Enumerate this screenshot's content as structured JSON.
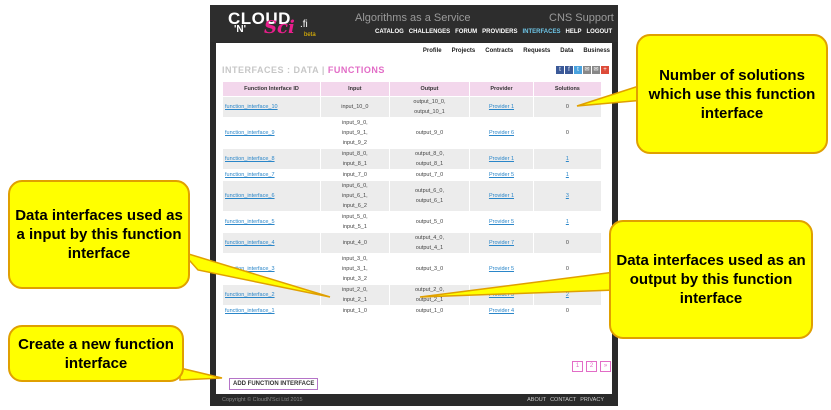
{
  "header": {
    "logo_main": "CLOUD",
    "logo_n": "'N'",
    "logo_sci": "Sci",
    "logo_fi": ".fi",
    "logo_beta": "beta",
    "tagline": "Algorithms as a Service",
    "support": "CNS Support"
  },
  "main_nav": [
    "CATALOG",
    "CHALLENGES",
    "FORUM",
    "PROVIDERS",
    "INTERFACES",
    "HELP",
    "LOGOUT"
  ],
  "main_nav_active": "INTERFACES",
  "sub_nav": [
    "Profile",
    "Projects",
    "Contracts",
    "Requests",
    "Data",
    "Business"
  ],
  "page": {
    "heading_prefix": "INTERFACES : DATA",
    "heading_sep": "|",
    "heading_current": "FUNCTIONS"
  },
  "social_icons": [
    "t",
    "f",
    "t",
    "✉",
    "✉",
    "+"
  ],
  "social_colors": [
    "#3b5998",
    "#3b5998",
    "#4aa3df",
    "#888888",
    "#888888",
    "#dd4b39"
  ],
  "table": {
    "headers": [
      "Function Interface ID",
      "Input",
      "Output",
      "Provider",
      "Solutions"
    ],
    "rows": [
      {
        "id": "function_interface_10",
        "inputs": [
          "input_10_0"
        ],
        "outputs": [
          "output_10_0,",
          "output_10_1"
        ],
        "provider": "Provider 1",
        "solutions": "0"
      },
      {
        "id": "function_interface_9",
        "inputs": [
          "input_9_0,",
          "input_9_1,",
          "input_9_2"
        ],
        "outputs": [
          "output_9_0"
        ],
        "provider": "Provider 6",
        "solutions": "0"
      },
      {
        "id": "function_interface_8",
        "inputs": [
          "input_8_0,",
          "input_8_1"
        ],
        "outputs": [
          "output_8_0,",
          "output_8_1"
        ],
        "provider": "Provider 1",
        "solutions": "1"
      },
      {
        "id": "function_interface_7",
        "inputs": [
          "input_7_0"
        ],
        "outputs": [
          "output_7_0"
        ],
        "provider": "Provider 5",
        "solutions": "1"
      },
      {
        "id": "function_interface_6",
        "inputs": [
          "input_6_0,",
          "input_6_1,",
          "input_6_2"
        ],
        "outputs": [
          "output_6_0,",
          "output_6_1"
        ],
        "provider": "Provider 1",
        "solutions": "3"
      },
      {
        "id": "function_interface_5",
        "inputs": [
          "input_5_0,",
          "input_5_1"
        ],
        "outputs": [
          "output_5_0"
        ],
        "provider": "Provider 5",
        "solutions": "1"
      },
      {
        "id": "function_interface_4",
        "inputs": [
          "input_4_0"
        ],
        "outputs": [
          "output_4_0,",
          "output_4_1"
        ],
        "provider": "Provider 7",
        "solutions": "0"
      },
      {
        "id": "function_interface_3",
        "inputs": [
          "input_3_0,",
          "input_3_1,",
          "input_3_2"
        ],
        "outputs": [
          "output_3_0"
        ],
        "provider": "Provider 5",
        "solutions": "0"
      },
      {
        "id": "function_interface_2",
        "inputs": [
          "input_2_0,",
          "input_2_1"
        ],
        "outputs": [
          "output_2_0,",
          "output_2_1"
        ],
        "provider": "Provider 3",
        "solutions": "2"
      },
      {
        "id": "function_interface_1",
        "inputs": [
          "input_1_0"
        ],
        "outputs": [
          "output_1_0"
        ],
        "provider": "Provider 4",
        "solutions": "0"
      }
    ]
  },
  "pagination": [
    "1",
    "2",
    "»"
  ],
  "add_button": "ADD FUNCTION INTERFACE",
  "footer": {
    "copyright": "Copyright © CloudN'Sci Ltd 2015",
    "links": [
      "ABOUT",
      "CONTACT",
      "PRIVACY"
    ]
  },
  "callouts": {
    "solutions": "Number of solutions which use this function interface",
    "inputs": "Data interfaces used as a input by this function interface",
    "outputs": "Data interfaces used as an output by this function interface",
    "add": "Create a new function interface"
  },
  "colors": {
    "accent_pink": "#e26cc6",
    "link_blue": "#2a86c9",
    "callout_yellow": "#ffff00",
    "header_dark": "#2d2d2d"
  }
}
